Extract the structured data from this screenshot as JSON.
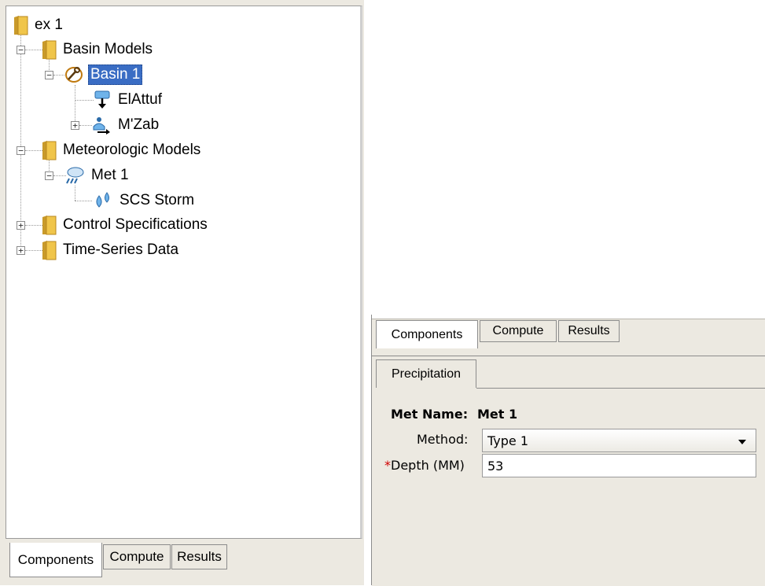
{
  "tree": {
    "root": "ex 1",
    "basin_models": "Basin Models",
    "basin": "Basin 1",
    "elattuf": "ElAttuf",
    "mzab": "M'Zab",
    "met_models": "Meteorologic Models",
    "met": "Met 1",
    "scs": "SCS Storm",
    "control": "Control Specifications",
    "timeseries": "Time-Series Data"
  },
  "left_tabs": {
    "components": "Components",
    "compute": "Compute",
    "results": "Results"
  },
  "right_tabs": {
    "components": "Components",
    "compute": "Compute",
    "results": "Results"
  },
  "editor": {
    "tab": "Precipitation",
    "met_name_label": "Met Name:",
    "met_name_value": "Met 1",
    "method_label": "Method:",
    "method_value": "Type 1",
    "required_marker": "*",
    "depth_label": "Depth (MM)",
    "depth_value": "53"
  },
  "colors": {
    "selection": "#3a6dc4",
    "folder": "#e8b83a",
    "required": "#d00000"
  }
}
